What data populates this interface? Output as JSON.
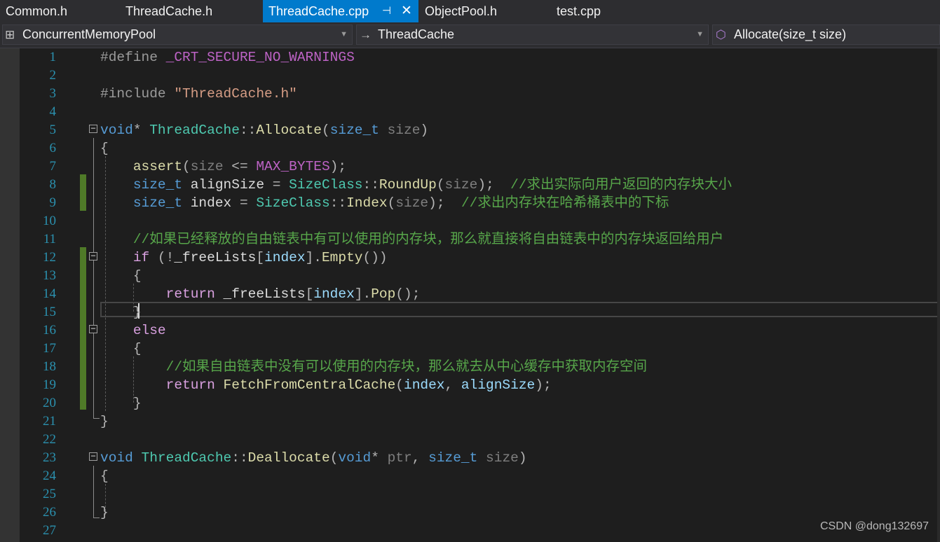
{
  "tabs": [
    {
      "label": "Common.h",
      "active": false
    },
    {
      "label": "ThreadCache.h",
      "active": false
    },
    {
      "label": "ThreadCache.cpp",
      "active": true
    },
    {
      "label": "ObjectPool.h",
      "active": false
    },
    {
      "label": "test.cpp",
      "active": false
    }
  ],
  "tab_icons": {
    "pin": "pin-icon",
    "close": "close-icon"
  },
  "nav": {
    "project": "ConcurrentMemoryPool",
    "scope": "ThreadCache",
    "member": "Allocate(size_t size)"
  },
  "colors": {
    "accent": "#007acc",
    "background": "#1e1e1e",
    "keyword": "#569cd6",
    "type": "#4ec9b0",
    "function": "#dcdcaa",
    "string": "#d69d85",
    "comment": "#57a64a",
    "line_number": "#2b91af"
  },
  "lines": [
    [
      [
        "pp",
        "#define "
      ],
      [
        "mac",
        "_CRT_SECURE_NO_WARNINGS"
      ]
    ],
    [],
    [
      [
        "pp",
        "#include "
      ],
      [
        "str",
        "\"ThreadCache.h\""
      ]
    ],
    [],
    [
      [
        "kw",
        "void"
      ],
      [
        "op",
        "* "
      ],
      [
        "ty",
        "ThreadCache"
      ],
      [
        "op",
        "::"
      ],
      [
        "fn",
        "Allocate"
      ],
      [
        "op",
        "("
      ],
      [
        "kw",
        "size_t"
      ],
      [
        "par",
        " size"
      ],
      [
        "op",
        ")"
      ]
    ],
    [
      [
        "op",
        "{"
      ]
    ],
    [
      [
        "id",
        "    "
      ],
      [
        "fn",
        "assert"
      ],
      [
        "op",
        "("
      ],
      [
        "par",
        "size"
      ],
      [
        "op",
        " <= "
      ],
      [
        "mac",
        "MAX_BYTES"
      ],
      [
        "op",
        ");"
      ]
    ],
    [
      [
        "id",
        "    "
      ],
      [
        "kw",
        "size_t"
      ],
      [
        "id",
        " alignSize "
      ],
      [
        "op",
        "= "
      ],
      [
        "ty",
        "SizeClass"
      ],
      [
        "op",
        "::"
      ],
      [
        "fn",
        "RoundUp"
      ],
      [
        "op",
        "("
      ],
      [
        "par",
        "size"
      ],
      [
        "op",
        ");  "
      ],
      [
        "cm",
        "//求出实际向用户返回的内存块大小"
      ]
    ],
    [
      [
        "id",
        "    "
      ],
      [
        "kw",
        "size_t"
      ],
      [
        "id",
        " index "
      ],
      [
        "op",
        "= "
      ],
      [
        "ty",
        "SizeClass"
      ],
      [
        "op",
        "::"
      ],
      [
        "fn",
        "Index"
      ],
      [
        "op",
        "("
      ],
      [
        "par",
        "size"
      ],
      [
        "op",
        ");  "
      ],
      [
        "cm",
        "//求出内存块在哈希桶表中的下标"
      ]
    ],
    [],
    [
      [
        "id",
        "    "
      ],
      [
        "cm",
        "//如果已经释放的自由链表中有可以使用的内存块，那么就直接将自由链表中的内存块返回给用户"
      ]
    ],
    [
      [
        "id",
        "    "
      ],
      [
        "ctl",
        "if"
      ],
      [
        "op",
        " (!"
      ],
      [
        "id",
        "_freeLists"
      ],
      [
        "op",
        "["
      ],
      [
        "var",
        "index"
      ],
      [
        "op",
        "]."
      ],
      [
        "fn",
        "Empty"
      ],
      [
        "op",
        "())"
      ]
    ],
    [
      [
        "id",
        "    "
      ],
      [
        "op",
        "{"
      ]
    ],
    [
      [
        "id",
        "        "
      ],
      [
        "ctl",
        "return"
      ],
      [
        "id",
        " _freeLists"
      ],
      [
        "op",
        "["
      ],
      [
        "var",
        "index"
      ],
      [
        "op",
        "]."
      ],
      [
        "fn",
        "Pop"
      ],
      [
        "op",
        "();"
      ]
    ],
    [
      [
        "id",
        "    "
      ],
      [
        "op",
        "}"
      ]
    ],
    [
      [
        "id",
        "    "
      ],
      [
        "ctl",
        "else"
      ]
    ],
    [
      [
        "id",
        "    "
      ],
      [
        "op",
        "{"
      ]
    ],
    [
      [
        "id",
        "        "
      ],
      [
        "cm",
        "//如果自由链表中没有可以使用的内存块，那么就去从中心缓存中获取内存空间"
      ]
    ],
    [
      [
        "id",
        "        "
      ],
      [
        "ctl",
        "return"
      ],
      [
        "id",
        " "
      ],
      [
        "fn",
        "FetchFromCentralCache"
      ],
      [
        "op",
        "("
      ],
      [
        "var",
        "index"
      ],
      [
        "op",
        ", "
      ],
      [
        "var",
        "alignSize"
      ],
      [
        "op",
        ");"
      ]
    ],
    [
      [
        "id",
        "    "
      ],
      [
        "op",
        "}"
      ]
    ],
    [
      [
        "op",
        "}"
      ]
    ],
    [],
    [
      [
        "kw",
        "void"
      ],
      [
        "id",
        " "
      ],
      [
        "ty",
        "ThreadCache"
      ],
      [
        "op",
        "::"
      ],
      [
        "fn",
        "Deallocate"
      ],
      [
        "op",
        "("
      ],
      [
        "kw",
        "void"
      ],
      [
        "op",
        "* "
      ],
      [
        "par",
        "ptr"
      ],
      [
        "op",
        ", "
      ],
      [
        "kw",
        "size_t"
      ],
      [
        "par",
        " size"
      ],
      [
        "op",
        ")"
      ]
    ],
    [
      [
        "op",
        "{"
      ]
    ],
    [],
    [
      [
        "op",
        "}"
      ]
    ],
    []
  ],
  "watermark": "CSDN @dong132697"
}
